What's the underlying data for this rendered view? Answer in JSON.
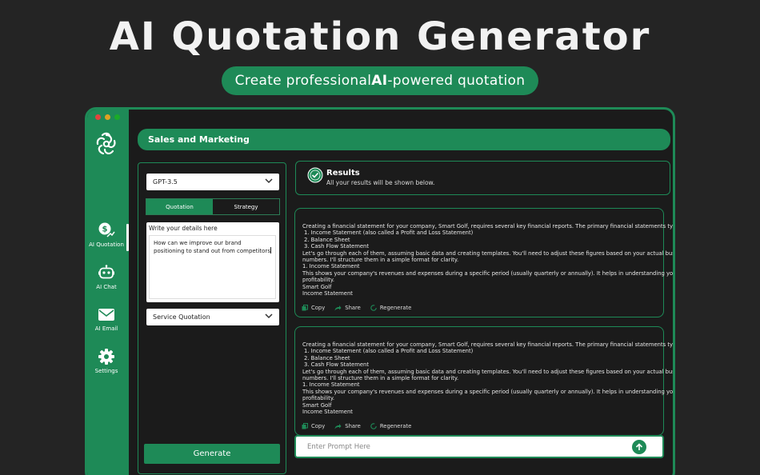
{
  "hero": {
    "title": "AI Quotation Generator",
    "subtitle_pre": "Create professional ",
    "subtitle_bold": "AI",
    "subtitle_post": "-powered quotation"
  },
  "colors": {
    "accent": "#1e8a57",
    "background": "#242424",
    "dot_red": "#e0443e",
    "dot_yellow": "#dea123",
    "dot_green": "#1aab29"
  },
  "sidebar": {
    "items": [
      {
        "label": "AI Quotation",
        "icon": "quotation-icon",
        "active": true
      },
      {
        "label": "AI Chat",
        "icon": "robot-icon",
        "active": false
      },
      {
        "label": "AI Email",
        "icon": "envelope-icon",
        "active": false
      },
      {
        "label": "Settings",
        "icon": "gear-icon",
        "active": false
      }
    ]
  },
  "header": {
    "title": "Sales and Marketing"
  },
  "left": {
    "model": "GPT-3.5",
    "tabs": [
      "Quotation",
      "Strategy"
    ],
    "active_tab": "Quotation",
    "details_label": "Write your details here",
    "details_value": "How can we improve our brand positioning to stand out from competitors",
    "service": "Service Quotation",
    "generate": "Generate"
  },
  "results": {
    "title": "Results",
    "subtitle": "All your results will be shown below."
  },
  "cards": [
    {
      "lines": [
        "Creating a financial statement for your company, Smart Golf, requires several key financial reports. The primary financial statements typically include:",
        "  1. Income Statement (also called a Profit and Loss Statement)",
        "  2. Balance Sheet",
        "  3. Cash Flow Statement",
        "Let's go through each of them, assuming basic data and creating templates. You'll need to adjust these figures based on your actual business",
        "numbers. I'll structure them in a simple format for clarity.",
        "1. Income Statement",
        "This shows your company's revenues and expenses during a specific period (usually quarterly or annually). It helps in understanding your company's",
        "profitability.",
        "Smart Golf",
        "Income Statement"
      ],
      "actions": [
        "Copy",
        "Share",
        "Regenerate"
      ]
    },
    {
      "lines": [
        "Creating a financial statement for your company, Smart Golf, requires several key financial reports. The primary financial statements typically include:",
        "  1. Income Statement (also called a Profit and Loss Statement)",
        "  2. Balance Sheet",
        "  3. Cash Flow Statement",
        "Let's go through each of them, assuming basic data and creating templates. You'll need to adjust these figures based on your actual business",
        "numbers. I'll structure them in a simple format for clarity.",
        "1. Income Statement",
        "This shows your company's revenues and expenses during a specific period (usually quarterly or annually). It helps in understanding your company's",
        "profitability.",
        "Smart Golf",
        "Income Statement"
      ],
      "actions": [
        "Copy",
        "Share",
        "Regenerate"
      ]
    }
  ],
  "prompt": {
    "placeholder": "Enter Prompt Here"
  }
}
